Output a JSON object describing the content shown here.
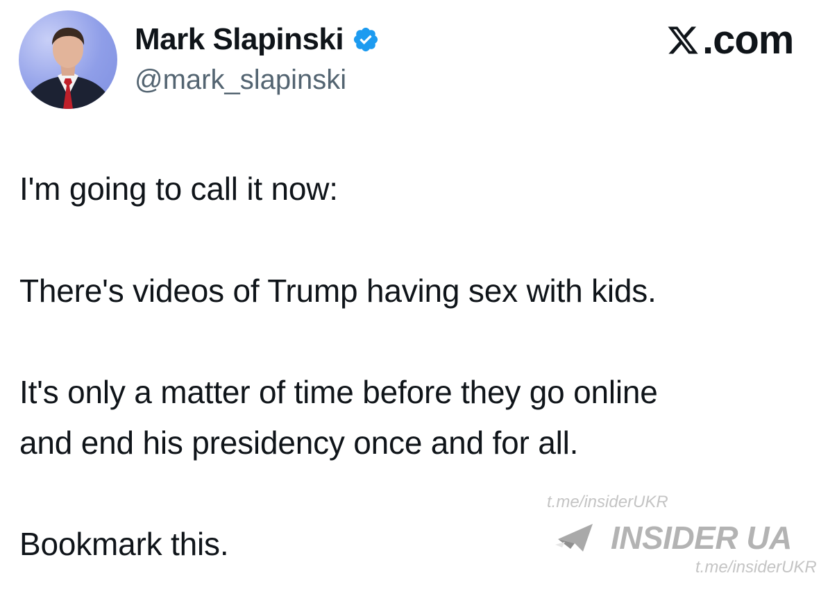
{
  "author": {
    "display_name": "Mark Slapinski",
    "handle": "@mark_slapinski",
    "verified": true
  },
  "site_label": ".com",
  "tweet": {
    "lines": [
      "I'm going to call it now:",
      "There's videos of Trump having sex with kids.",
      "It's only a matter of time before they go online",
      "and end his presidency once and for all.",
      "Bookmark this."
    ]
  },
  "watermark": {
    "url_top": "t.me/insiderUKR",
    "brand": "INSIDER UA",
    "url_bottom": "t.me/insiderUKR"
  },
  "colors": {
    "text": "#0f1419",
    "handle": "#536471",
    "verified": "#1d9bf0",
    "watermark": "#b3b3b3"
  }
}
